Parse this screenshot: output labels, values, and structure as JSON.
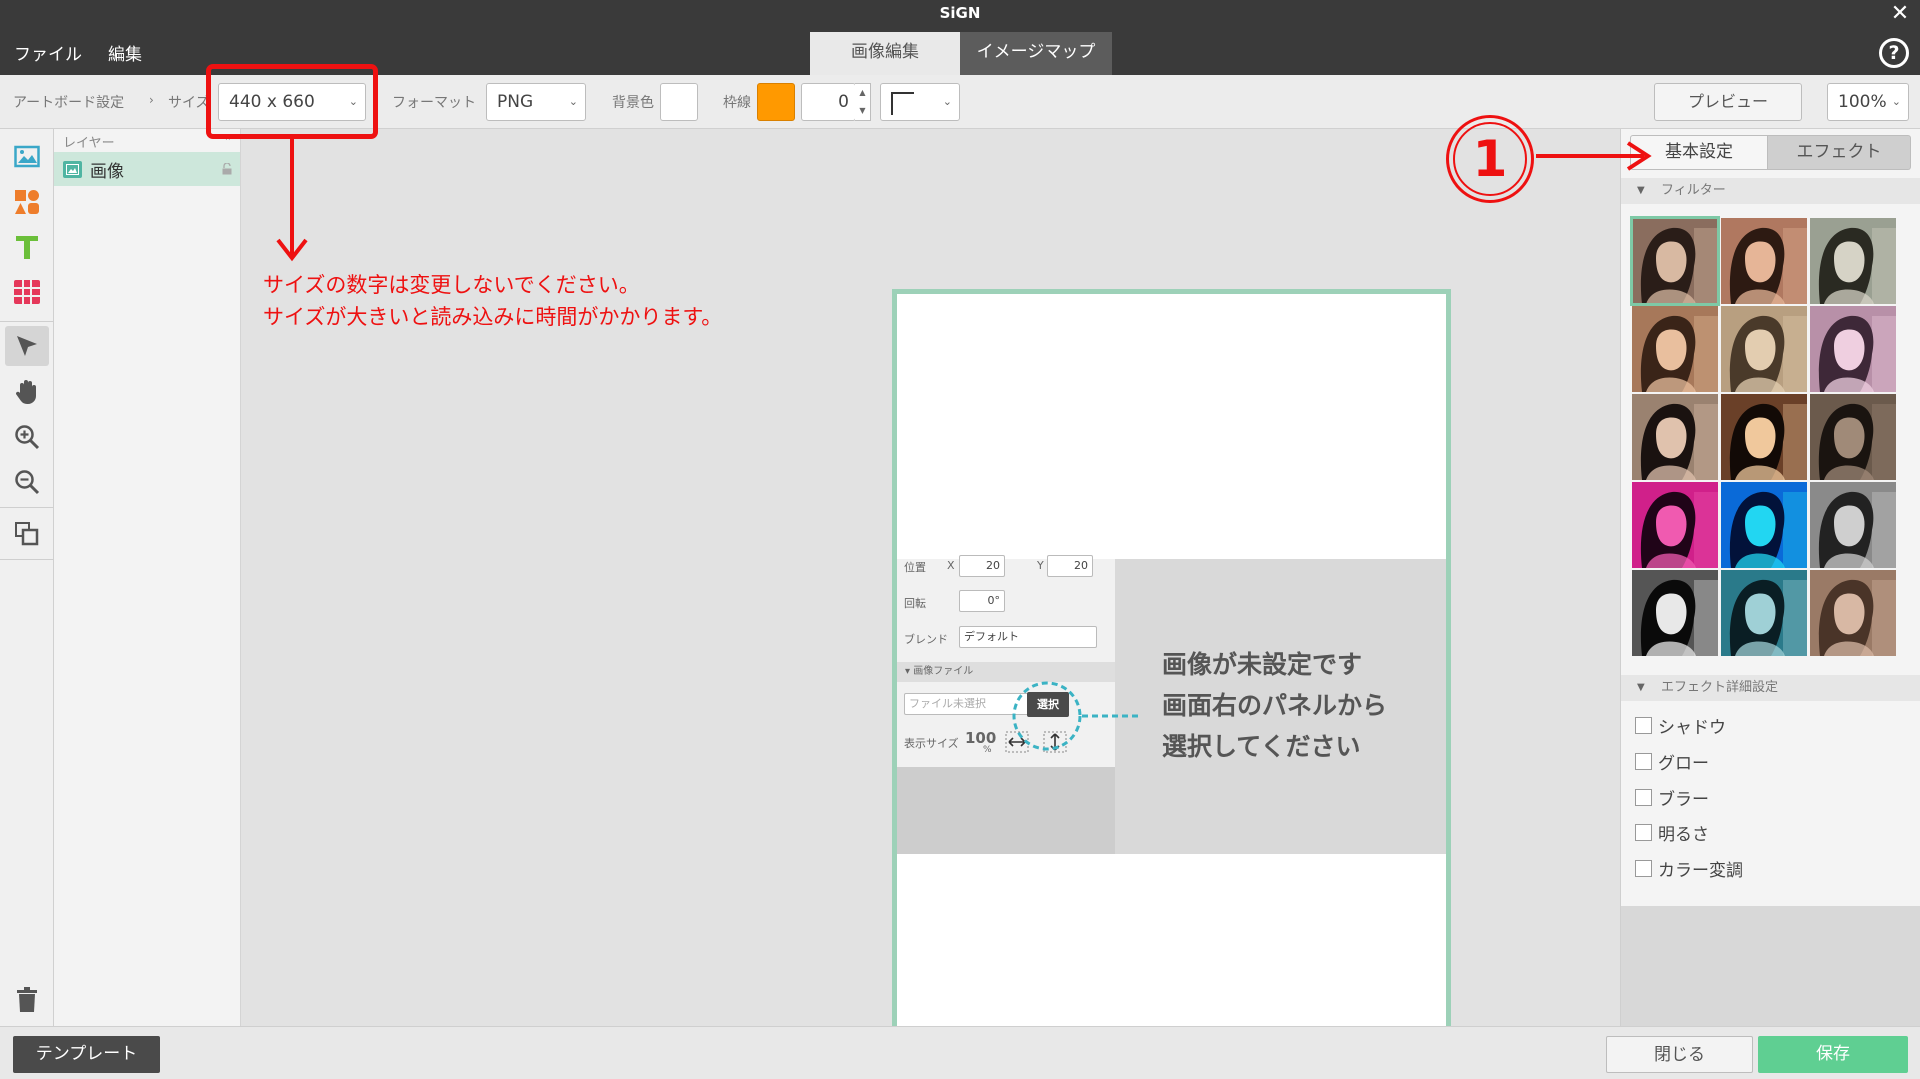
{
  "app_title": "SiGN",
  "menu": [
    "ファイル",
    "編集"
  ],
  "mode_tabs": {
    "edit": "画像編集",
    "imagemap": "イメージマップ"
  },
  "help": "?",
  "close": "✕",
  "toolbar": {
    "artboard": "アートボード設定",
    "size_label": "サイズ",
    "size_value": "440 x 660",
    "format_label": "フォーマット",
    "format_value": "PNG",
    "bg_label": "背景色",
    "border_label": "枠線",
    "border_value": "0",
    "preview": "プレビュー",
    "zoom": "100%"
  },
  "layers": {
    "header": "レイヤー",
    "collapse": "«",
    "items": [
      {
        "name": "画像"
      }
    ]
  },
  "placeholder": {
    "pos_label": "位置",
    "x_label": "X",
    "x_value": "20",
    "y_label": "Y",
    "y_value": "20",
    "rotate_label": "回転",
    "rotate_value": "0°",
    "blend_label": "ブレンド",
    "blend_value": "デフォルト",
    "file_section": "画像ファイル",
    "file_placeholder": "ファイル未選択",
    "select_btn": "選択",
    "display_size": "表示サイズ",
    "display_value": "100",
    "display_unit": "%",
    "message": [
      "画像が未設定です",
      "画面右のパネルから",
      "選択してください"
    ]
  },
  "right_panel": {
    "tab_basic": "基本設定",
    "tab_effect": "エフェクト",
    "filter_header": "フィルター",
    "effect_header": "エフェクト詳細設定",
    "effects": [
      "シャドウ",
      "グロー",
      "ブラー",
      "明るさ",
      "カラー変調"
    ]
  },
  "filters": [
    {
      "bg": "#8a6d5e",
      "face": "#d8b9a2",
      "hair": "#2a1d18"
    },
    {
      "bg": "#b07860",
      "face": "#e6b597",
      "hair": "#2d1a12"
    },
    {
      "bg": "#9aa092",
      "face": "#d6d3c6",
      "hair": "#2a2a22"
    },
    {
      "bg": "#a7785a",
      "face": "#e9bf9e",
      "hair": "#3a2418"
    },
    {
      "bg": "#b89f80",
      "face": "#e3cdb0",
      "hair": "#4a3a2a"
    },
    {
      "bg": "#b890a8",
      "face": "#efcfe0",
      "hair": "#3e2838"
    },
    {
      "bg": "#9a8270",
      "face": "#e0c2ad",
      "hair": "#1a1210"
    },
    {
      "bg": "#6a4028",
      "face": "#f0c89c",
      "hair": "#120a06"
    },
    {
      "bg": "#6b5a4c",
      "face": "#a08a78",
      "hair": "#1a1410"
    },
    {
      "bg": "#d0208a",
      "face": "#f05ab0",
      "hair": "#200418"
    },
    {
      "bg": "#0a6ad8",
      "face": "#22d6f2",
      "hair": "#02123a"
    },
    {
      "bg": "#8a8a8a",
      "face": "#cfcfcf",
      "hair": "#222222"
    },
    {
      "bg": "#555555",
      "face": "#e8e8e8",
      "hair": "#0a0a0a"
    },
    {
      "bg": "#2a7a8a",
      "face": "#9fd0d6",
      "hair": "#0a1e24"
    },
    {
      "bg": "#9a7a66",
      "face": "#d8b8a4",
      "hair": "#4a3428"
    }
  ],
  "bottom": {
    "template": "テンプレート",
    "close": "閉じる",
    "save": "保存"
  },
  "annotations": {
    "note_line1": "サイズの数字は変更しないでください。",
    "note_line2": "サイズが大きいと読み込みに時間がかかります。",
    "marker": "1"
  },
  "colors": {
    "accent_green": "#5fcf92",
    "border_orange": "#ff9900",
    "annotation_red": "#ee1111",
    "artboard_border": "#9dd1b8"
  }
}
